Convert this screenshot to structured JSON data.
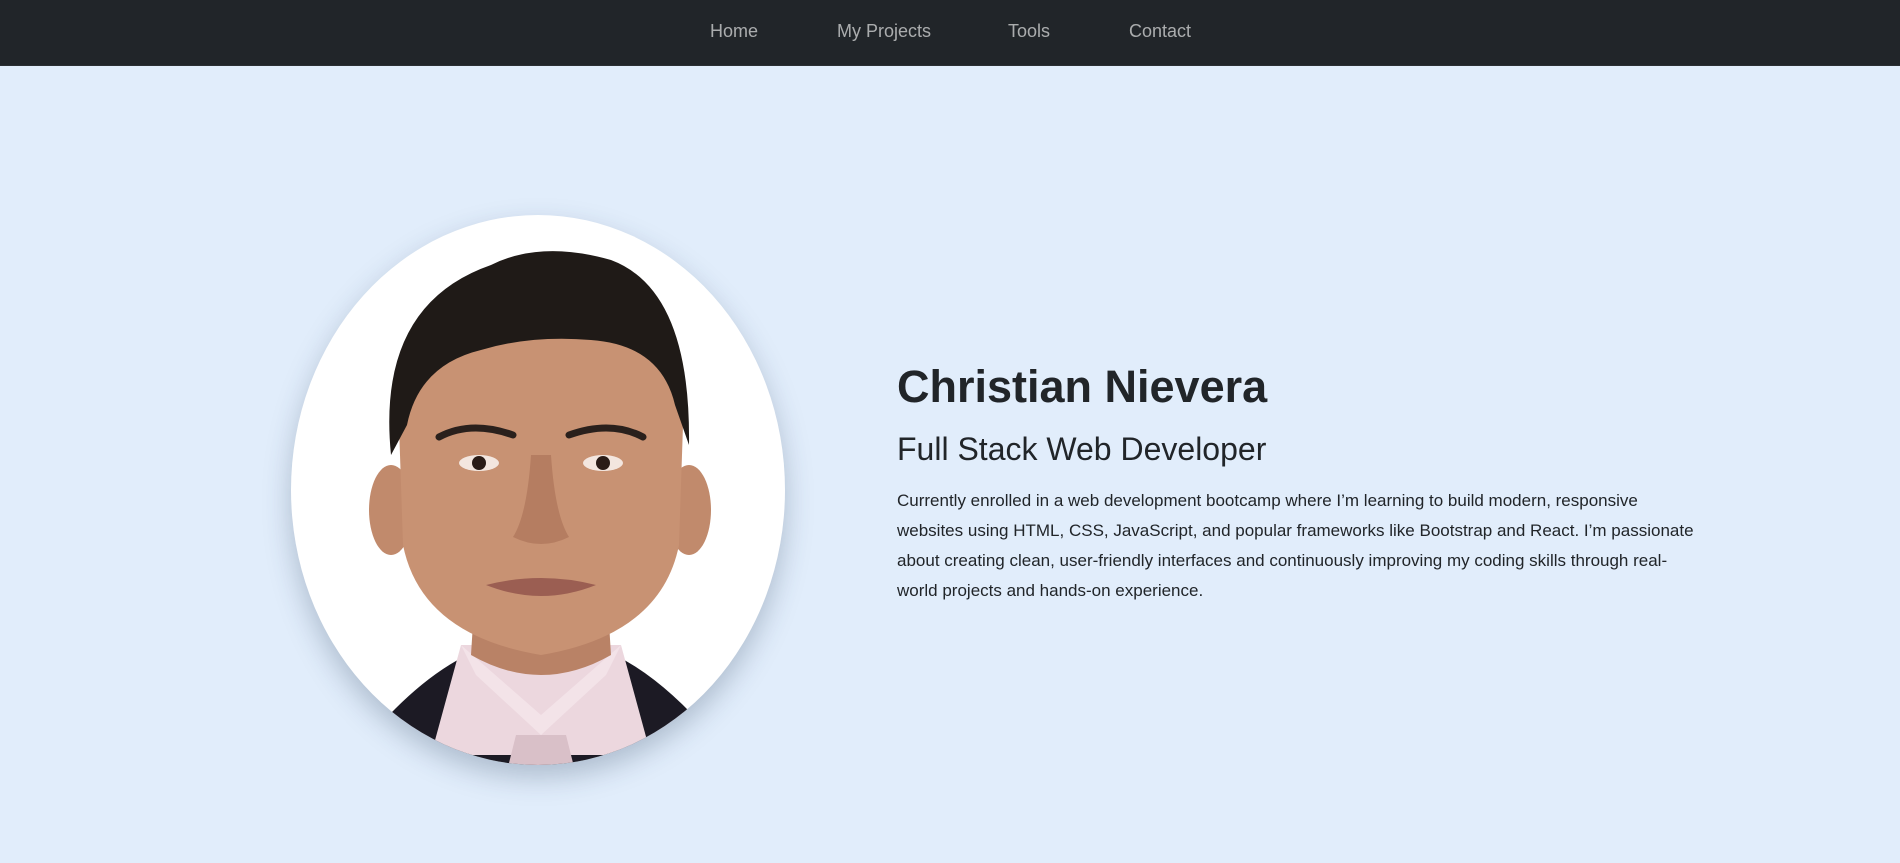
{
  "nav": {
    "items": [
      {
        "label": "Home"
      },
      {
        "label": "My Projects"
      },
      {
        "label": "Tools"
      },
      {
        "label": "Contact"
      }
    ]
  },
  "hero": {
    "name": "Christian Nievera",
    "role": "Full Stack Web Developer",
    "bio": "Currently enrolled in a web development bootcamp where I’m learning to build modern, responsive websites using HTML, CSS, JavaScript, and popular frameworks like Bootstrap and React. I’m passionate about creating clean, user-friendly interfaces and continuously improving my coding skills through real-world projects and hands-on experience."
  },
  "colors": {
    "navbar_bg": "#212529",
    "page_bg": "#e1edfb",
    "nav_text": "#9a9da0",
    "text": "#212529"
  }
}
